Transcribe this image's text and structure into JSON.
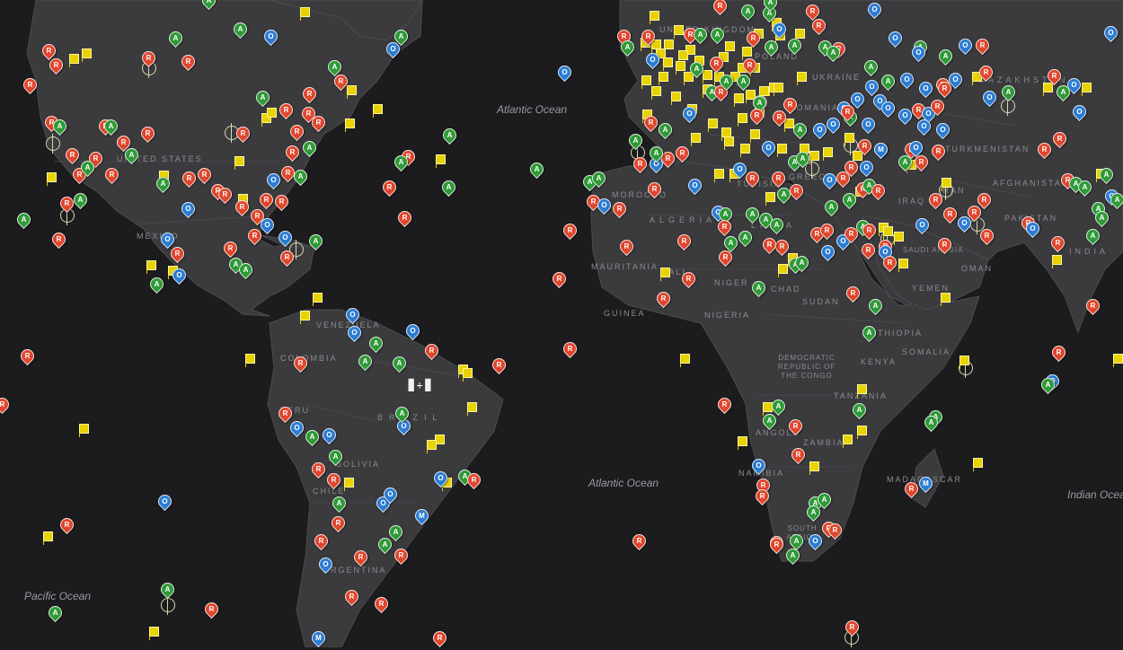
{
  "colors": {
    "background": "#1c1c1e",
    "land": "#3b3b3e",
    "R": "#e0462c",
    "A": "#2f9a37",
    "O": "#2b7cd3",
    "M": "#2b7cd3",
    "flag": "#e8d200"
  },
  "ocean_labels": {
    "atlantic_north": "Atlantic Ocean",
    "atlantic_south": "Atlantic Ocean",
    "pacific": "Pacific Ocean",
    "indian": "Indian Ocean"
  },
  "country_labels": {
    "us": "UNITED STATES",
    "mexico": "MEXICO",
    "venezuela": "VENEZUELA",
    "colombia": "COLOMBIA",
    "peru": "PERU",
    "brazil": "BRAZIL",
    "bolivia": "BOLIVIA",
    "chile": "CHILE",
    "argentina": "ARGENTINA",
    "ukraine": "UKRAINE",
    "kazakhstan": "KAZAKHSTAN",
    "romania": "ROMANIA",
    "turkmenistan": "TURKMENISTAN",
    "afghanistan": "AFGHANISTAN",
    "pakistan": "PAKISTAN",
    "india": "INDIA",
    "iraq": "IRAQ",
    "iran": "IRAN",
    "saudi": "SAUDI ARABIA",
    "oman": "OMAN",
    "yemen": "YEMEN",
    "morocco": "MOROCCO",
    "algeria": "ALGERIA",
    "libya": "LIBYA",
    "tunisia": "TUNISIA",
    "greece": "GREECE",
    "mauritania": "MAURITANIA",
    "mali": "MALI",
    "niger": "NIGER",
    "chad": "CHAD",
    "sudan": "SUDAN",
    "guinea": "GUINEA",
    "nigeria": "NIGERIA",
    "ethiopia": "ETHIOPIA",
    "somalia": "SOMALIA",
    "kenya": "KENYA",
    "drc": "DEMOCRATIC REPUBLIC OF THE CONGO",
    "tanzania": "TANZANIA",
    "angola": "ANGOLA",
    "zambia": "ZAMBIA",
    "namibia": "NAMIBIA",
    "madagascar": "MADAGASCAR",
    "south_africa": "SOUTH AFRICA",
    "poland": "POLAND",
    "united_kingdom": "UNITED KINGDOM"
  },
  "legend_letters": [
    "R",
    "A",
    "O",
    "M"
  ]
}
